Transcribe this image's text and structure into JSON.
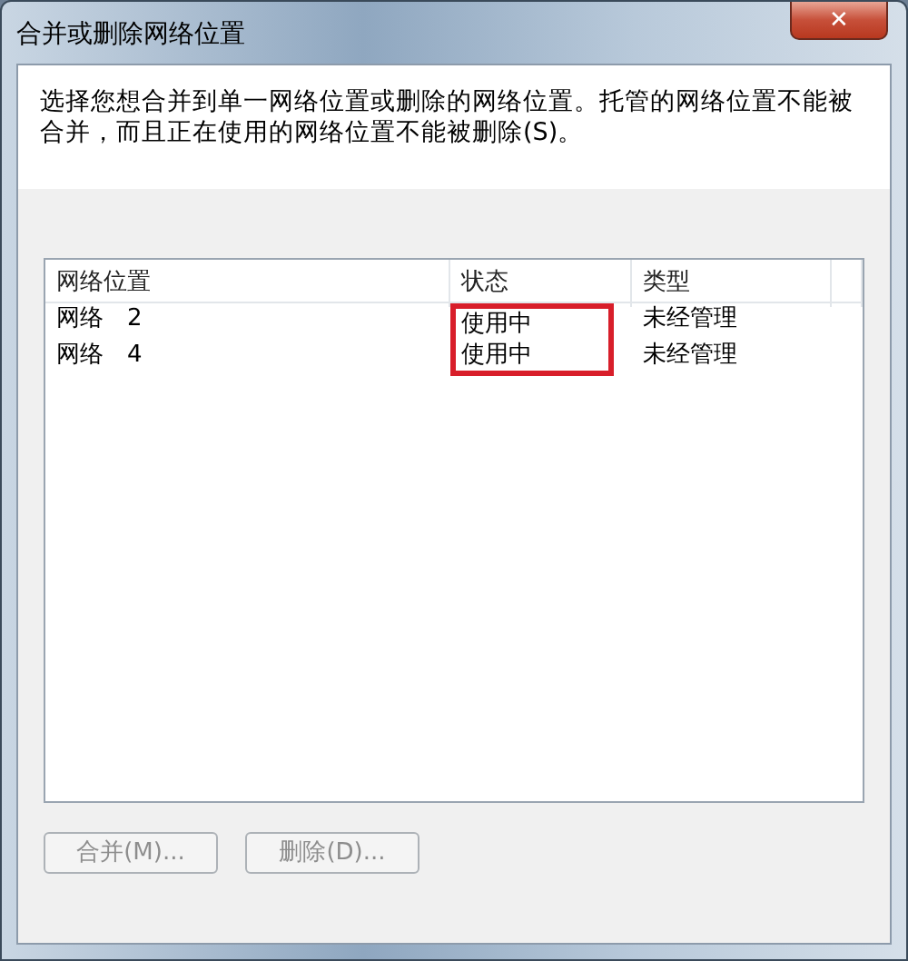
{
  "window": {
    "title": "合并或删除网络位置",
    "close_label": "✕"
  },
  "instruction": "选择您想合并到单一网络位置或删除的网络位置。托管的网络位置不能被合并，而且正在使用的网络位置不能被删除(S)。",
  "table": {
    "columns": [
      "网络位置",
      "状态",
      "类型"
    ],
    "rows": [
      {
        "cells": [
          "网络　2",
          "使用中",
          "未经管理"
        ],
        "status_highlighted": true
      },
      {
        "cells": [
          "网络　4",
          "使用中",
          "未经管理"
        ],
        "status_highlighted": true
      }
    ]
  },
  "buttons": [
    {
      "label": "合并(M)...",
      "disabled": true
    },
    {
      "label": "删除(D)...",
      "disabled": true
    }
  ]
}
